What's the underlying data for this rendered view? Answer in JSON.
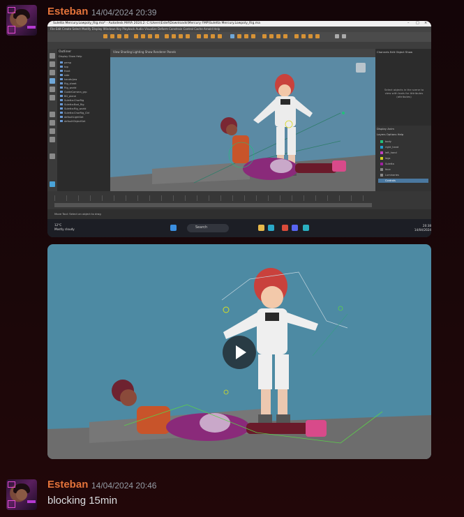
{
  "messages": [
    {
      "author": "Esteban",
      "timestamp": "14/04/2024 20:39",
      "attachments": [
        {
          "kind": "image",
          "window_title": "Suletta Mercury.Lowpoly_Rig.ma* - Autodesk MAYA 2024.2: C:\\Users\\Estef\\Downloads\\Mercury FMP\\Suletta Mercury.Lowpoly_Rig.ma",
          "menu": "File  Edit  Create  Select  Modify  Display  Windows  Key  Playback  Audio  Visualize  Deform  Constrain  Control  Cache  Arnold  Help",
          "outliner_title": "Outliner",
          "outliner_menu": "Display  Show  Help",
          "outliner_items": [
            "persp",
            "top",
            "front",
            "side",
            "hands:Jaw",
            "Rig_sheet",
            "Rig_world",
            "GuideCamera_grp",
            "BG_plane",
            "Suletta:CharRig",
            "Suletta:Bod_Rig",
            "Suletta:Rig_world",
            "Suletta:CharRig_Ctrl",
            "defaultLightSet",
            "defaultObjectSet"
          ],
          "viewport_menu": "View  Shading  Lighting  Show  Renderer  Panels",
          "attr_panel_tabs": "Channels  Edit  Object  Show",
          "attr_panel_message": "Select objects in the scene to view\nwith tools for Attributes (attributes)",
          "layer_tabs": "Display  Anim",
          "layer_menu": "Layers  Options  Help",
          "layers": [
            "body",
            "right_hand",
            "left_hand",
            "legs",
            "Suletta",
            "face",
            "Luminaries",
            "Controls"
          ],
          "cmd_status": "Move Tool: Select an object to drag",
          "taskbar_search": "Search",
          "weather": "12°C\nMostly cloudy",
          "clock": "20:38\n14/04/2024"
        },
        {
          "kind": "video",
          "play_label": "Play"
        }
      ]
    },
    {
      "author": "Esteban",
      "timestamp": "14/04/2024 20:46",
      "text": "blocking 15min"
    }
  ],
  "colors": {
    "author": "#e3733a",
    "timestamp": "#949ba4",
    "text": "#dbdee1",
    "viewport_bg": "#5b8aa4",
    "video_bg": "#4d8aa3"
  }
}
